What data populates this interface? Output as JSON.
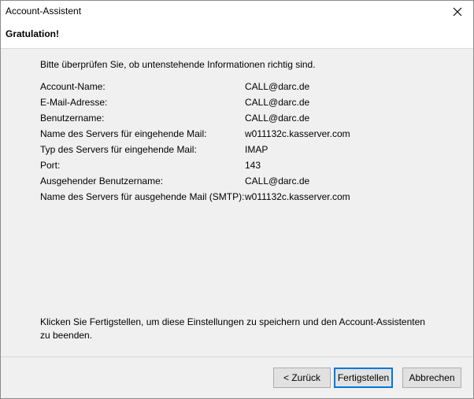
{
  "window": {
    "title": "Account-Assistent"
  },
  "header": {
    "title": "Gratulation!"
  },
  "content": {
    "intro": "Bitte überprüfen Sie, ob untenstehende Informationen richtig sind.",
    "rows": [
      {
        "label": "Account-Name:",
        "value": "CALL@darc.de"
      },
      {
        "label": "E-Mail-Adresse:",
        "value": "CALL@darc.de"
      },
      {
        "label": "Benutzername:",
        "value": "CALL@darc.de"
      },
      {
        "label": "Name des Servers für eingehende Mail:",
        "value": "w011132c.kasserver.com"
      },
      {
        "label": "Typ des Servers für eingehende Mail:",
        "value": "IMAP"
      },
      {
        "label": "Port:",
        "value": "143"
      },
      {
        "label": "Ausgehender Benutzername:",
        "value": "CALL@darc.de"
      },
      {
        "label": "Name des Servers für ausgehende Mail (SMTP):",
        "value": "w011132c.kasserver.com"
      }
    ],
    "finish_note": "Klicken Sie Fertigstellen, um diese Einstellungen zu speichern und den Account-Assistenten zu beenden."
  },
  "buttons": {
    "back": "< Zurück",
    "finish": "Fertigstellen",
    "cancel": "Abbrechen"
  },
  "icons": {
    "close": "close-icon"
  },
  "colors": {
    "focus_border": "#0078d7",
    "dialog_background": "#f0f0f0"
  }
}
